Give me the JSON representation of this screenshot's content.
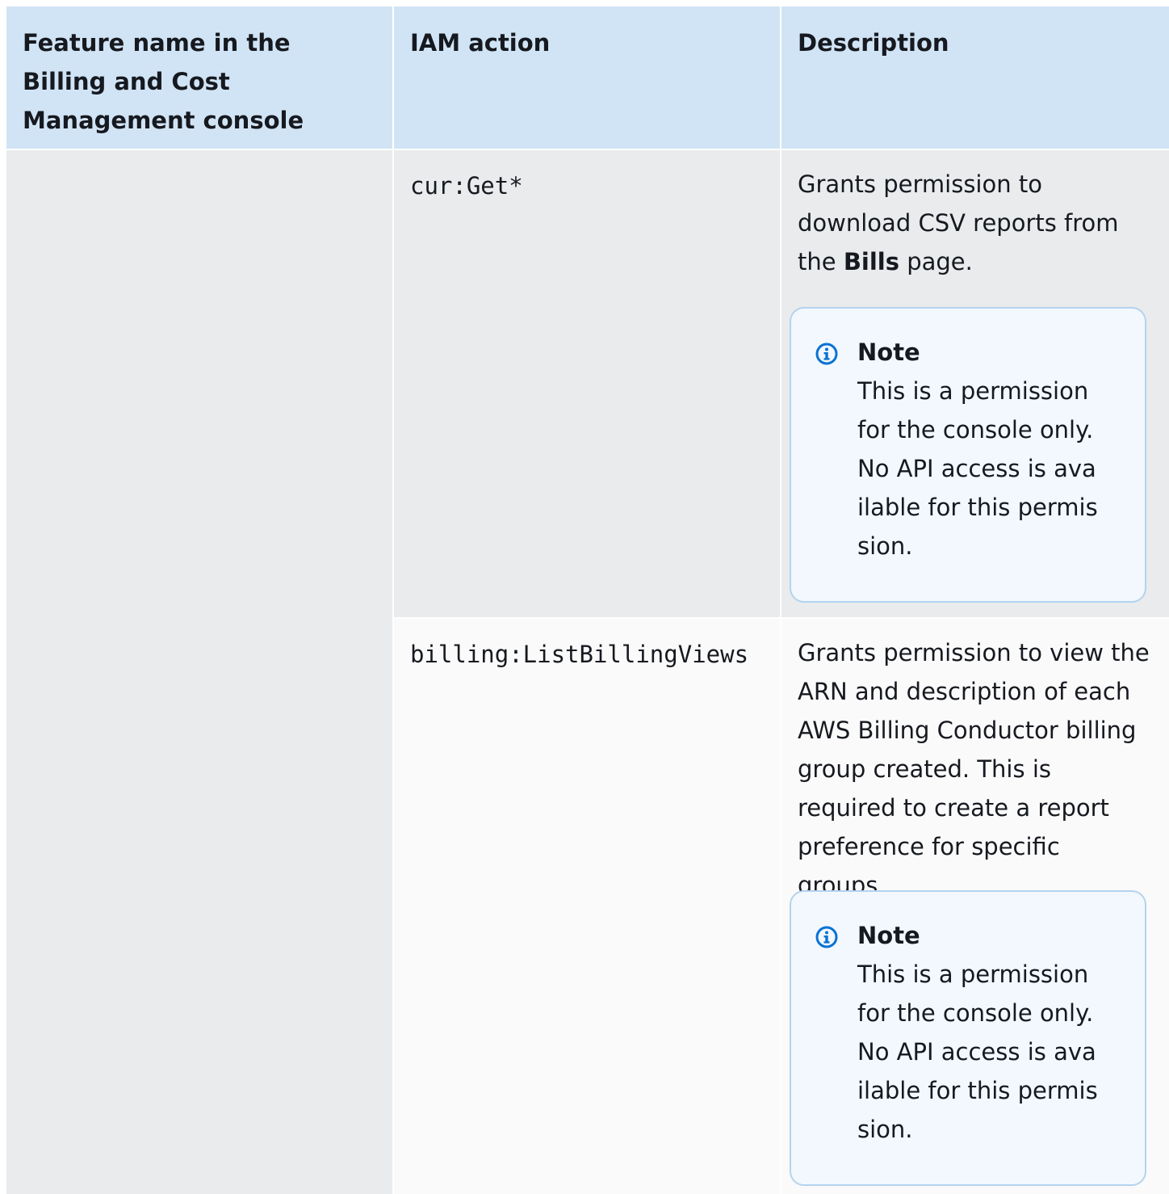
{
  "table": {
    "headers": [
      "Feature name in the Billing and Cost Management console",
      "IAM action",
      "Description"
    ],
    "rows": [
      {
        "feature": "",
        "action": "cur:Get*",
        "description_before": "Grants permission to download CSV reports from the ",
        "description_strong": "Bills",
        "description_after": " page.",
        "note_title": "Note",
        "note_body": "This is a permission for the console only. No API access is available for this permission."
      },
      {
        "feature": "",
        "action": "billing:ListBillingViews",
        "description": "Grants permission to view the ARN and description of each AWS Billing Conductor billing group created. This is required to create a report preference for specific groups.",
        "note_title": "Note",
        "note_body": "This is a permission for the console only. No API access is available for this permission."
      }
    ]
  },
  "colors": {
    "header_bg": "#d1e4f5",
    "row_shaded_bg": "#e9ebed",
    "row_light_bg": "#fafafa",
    "note_border": "#b4d3ee",
    "note_bg": "#f2f8fd",
    "info_icon": "#0972d3"
  },
  "icons": {
    "note_icon": "info-icon"
  }
}
